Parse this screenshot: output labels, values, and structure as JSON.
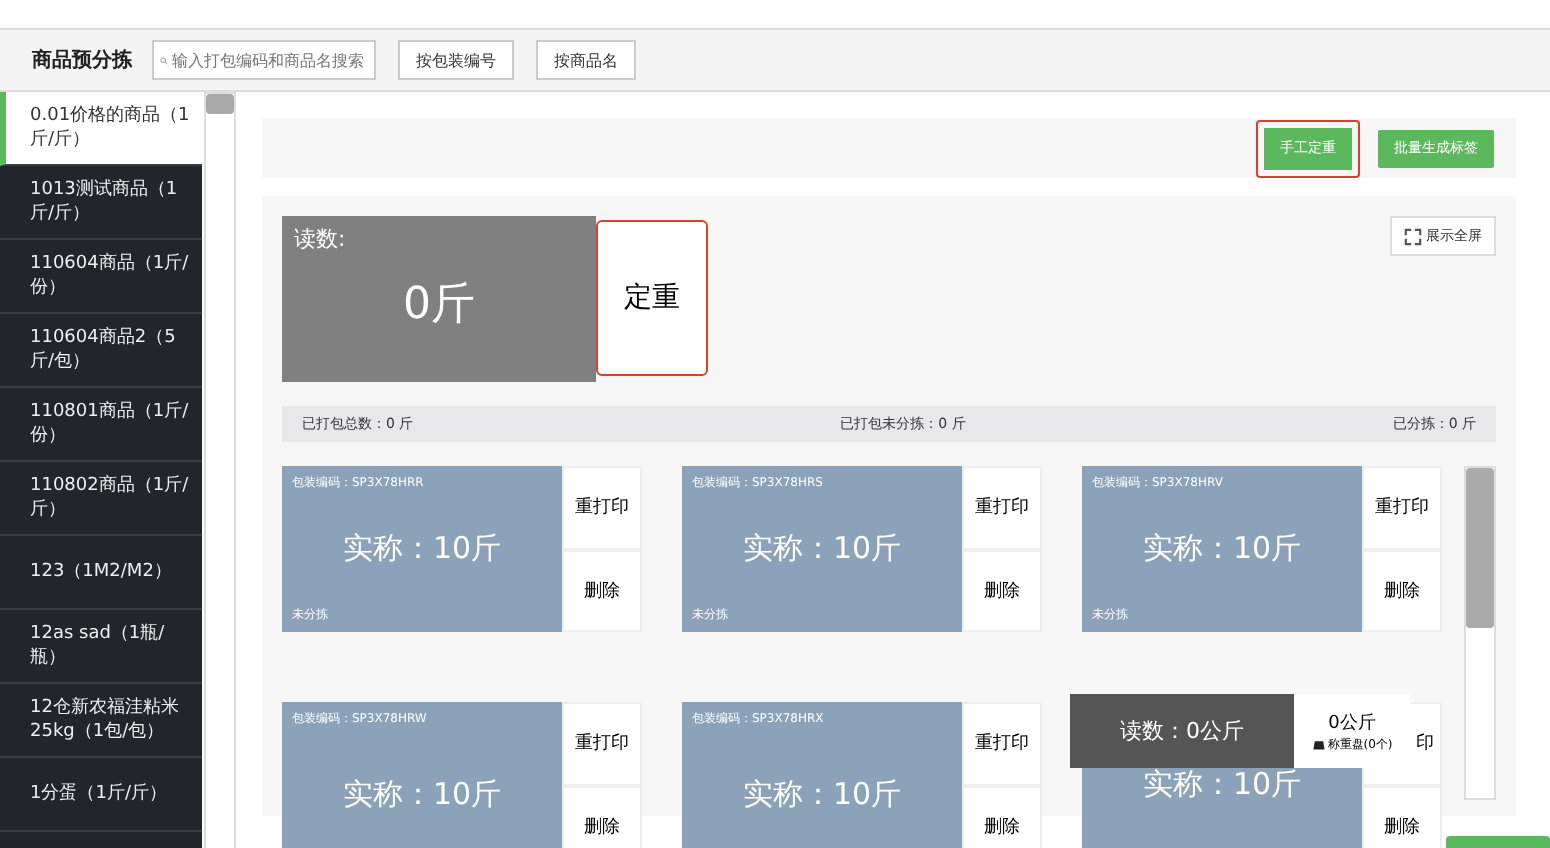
{
  "toolbar": {
    "title": "商品预分拣",
    "search": {
      "placeholder": "输入打包编码和商品名搜索"
    },
    "buttons": [
      "按包装编号",
      "按商品名"
    ]
  },
  "sidebar": {
    "items": [
      {
        "label": "0.01价格的商品（1斤/斤）",
        "selected": true
      },
      {
        "label": "1013测试商品（1斤/斤）",
        "selected": false
      },
      {
        "label": "110604商品（1斤/份）",
        "selected": false
      },
      {
        "label": "110604商品2（5斤/包）",
        "selected": false
      },
      {
        "label": "110801商品（1斤/份）",
        "selected": false
      },
      {
        "label": "110802商品（1斤/斤）",
        "selected": false
      },
      {
        "label": "123（1M2/M2）",
        "selected": false
      },
      {
        "label": "12as sad（1瓶/瓶）",
        "selected": false
      },
      {
        "label": "12仓新农福洼粘米25kg（1包/包）",
        "selected": false
      },
      {
        "label": "1分蛋（1斤/斤）",
        "selected": false
      }
    ]
  },
  "actions": [
    {
      "label": "手工定重",
      "highlighted": true
    },
    {
      "label": "批量生成标签",
      "highlighted": false
    }
  ],
  "scale": {
    "reading_label": "读数:",
    "reading": "0斤",
    "set_weight": "定重",
    "fullscreen": "展示全屏"
  },
  "stats": [
    "已打包总数：0 斤",
    "已打包未分拣：0 斤",
    "已分拣：0 斤"
  ],
  "packages": [
    {
      "code": "包装编码：SP3X78HRR",
      "weight": "实称：10斤",
      "status": "未分拣",
      "reprint": "重打印",
      "delete": "删除"
    },
    {
      "code": "包装编码：SP3X78HRS",
      "weight": "实称：10斤",
      "status": "未分拣",
      "reprint": "重打印",
      "delete": "删除"
    },
    {
      "code": "包装编码：SP3X78HRV",
      "weight": "实称：10斤",
      "status": "未分拣",
      "reprint": "重打印",
      "delete": "删除"
    },
    {
      "code": "包装编码：SP3X78HRW",
      "weight": "实称：10斤",
      "reprint": "重打印",
      "delete": "删除"
    },
    {
      "code": "包装编码：SP3X78HRX",
      "weight": "实称：10斤",
      "reprint": "重打印",
      "delete": "删除"
    },
    {
      "weight": "实称：10斤",
      "reprint": "印",
      "delete": "删除",
      "covered": true
    }
  ],
  "floating_scale": {
    "reading": "读数：0公斤",
    "value": "0公斤",
    "plates": "称重盘(0个)"
  }
}
